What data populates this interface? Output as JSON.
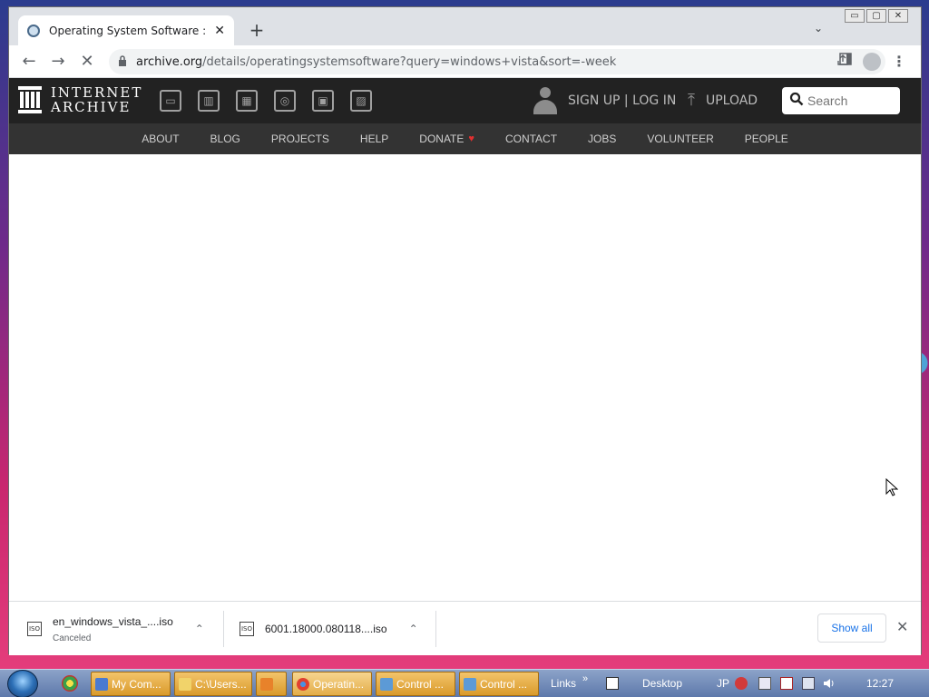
{
  "window": {
    "minimize_glyph": "▭",
    "maximize_glyph": "▢",
    "close_glyph": "✕"
  },
  "tabs": [
    {
      "title": "Operating System Software : Free",
      "close_glyph": "✕"
    }
  ],
  "tabstrip": {
    "new_tab_glyph": "+",
    "tab_search_glyph": "⌄"
  },
  "toolbar": {
    "back_glyph": "←",
    "forward_glyph": "→",
    "reload_glyph": "✕",
    "url_host": "archive.org",
    "url_path": "/details/operatingsystemsoftware?query=windows+vista&sort=-week",
    "kebab_glyph": "⋮"
  },
  "ia_header": {
    "logo_line1": "INTERNET",
    "logo_line2": "ARCHIVE",
    "media_icons": [
      "web-icon",
      "texts-icon",
      "video-icon",
      "audio-icon",
      "software-icon",
      "images-icon"
    ],
    "signup_login": "SIGN UP | LOG IN",
    "upload": "UPLOAD",
    "search_placeholder": "Search"
  },
  "ia_nav": {
    "items": [
      "ABOUT",
      "BLOG",
      "PROJECTS",
      "HELP",
      "DONATE",
      "CONTACT",
      "JOBS",
      "VOLUNTEER",
      "PEOPLE"
    ],
    "heart_glyph": "♥"
  },
  "downloads": {
    "items": [
      {
        "name": "en_windows_vista_....iso",
        "status": "Canceled",
        "icon_text": "ISO"
      },
      {
        "name": "6001.18000.080118....iso",
        "status": "",
        "icon_text": "ISO"
      }
    ],
    "chevron_glyph": "⌃",
    "show_all": "Show all",
    "close_glyph": "✕"
  },
  "taskbar": {
    "buttons": [
      "My Com...",
      "C:\\Users...",
      "",
      "Operatin...",
      "Control ...",
      "Control ..."
    ],
    "links_label": "Links",
    "desktop_label": "Desktop",
    "lang": "JP",
    "clock": "12:27",
    "overflow_glyph": "»"
  },
  "colors": {
    "ia_top": "#222222",
    "ia_nav": "#333333",
    "heart": "#e03030",
    "link_blue": "#1a73e8",
    "taskbar_button": "#e3ad49"
  }
}
